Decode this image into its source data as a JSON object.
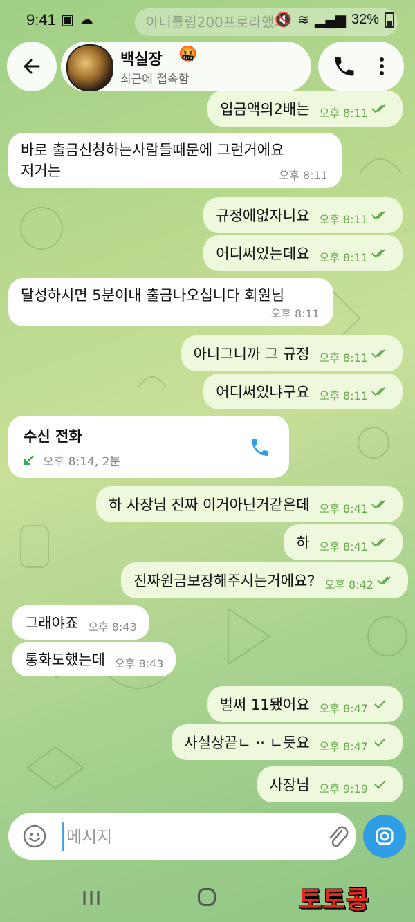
{
  "status_bar": {
    "time": "9:41",
    "battery": "32%",
    "notification_ghost": "아니를링200프로라했지"
  },
  "header": {
    "contact_name": "백실장",
    "contact_emoji": "🤬",
    "contact_status": "최근에 접속함",
    "back_label": "뒤로",
    "icons": [
      "back-arrow-icon",
      "phone-icon",
      "more-vert-icon"
    ]
  },
  "messages": [
    {
      "dir": "out",
      "text": "입금액의2배는",
      "time": "오후 8:11",
      "read": true
    },
    {
      "dir": "in",
      "text": "바로 출금신청하는사람들때문에 그런거에요\n저거는",
      "time": "오후 8:11"
    },
    {
      "dir": "out",
      "text": "규정에없자니요",
      "time": "오후 8:11",
      "read": true
    },
    {
      "dir": "out",
      "text": "어디써있는데요",
      "time": "오후 8:11",
      "read": true
    },
    {
      "dir": "in",
      "text": "달성하시면 5분이내 출금나오십니다 회원님",
      "time": "오후 8:11"
    },
    {
      "dir": "out",
      "text": "아니그니까 그 규정",
      "time": "오후 8:11",
      "read": true
    },
    {
      "dir": "out",
      "text": "어디써있냐구요",
      "time": "오후 8:11",
      "read": true
    },
    {
      "dir": "call",
      "title": "수신 전화",
      "meta": "오후 8:14, 2분"
    },
    {
      "dir": "out",
      "text": "하 사장님 진짜 이거아닌거같은데",
      "time": "오후 8:41",
      "read": true
    },
    {
      "dir": "out",
      "text": "하",
      "time": "오후 8:41",
      "read": true
    },
    {
      "dir": "out",
      "text": "진짜원금보장해주시는거에요?",
      "time": "오후 8:42",
      "read": true
    },
    {
      "dir": "in",
      "text": "그래야죠",
      "time": "오후 8:43"
    },
    {
      "dir": "in",
      "text": "통화도했는데",
      "time": "오후 8:43"
    },
    {
      "dir": "out",
      "text": "벌써 11됐어요",
      "time": "오후 8:47",
      "read": false
    },
    {
      "dir": "out",
      "text": "사실상끝ㄴ ·· ㄴ듯요",
      "time": "오후 8:47",
      "read": false
    },
    {
      "dir": "out",
      "text": "사장님",
      "time": "오후 9:19",
      "read": false
    }
  ],
  "composer": {
    "placeholder": "메시지"
  },
  "watermark": "토토콩",
  "colors": {
    "accent": "#2f9ee6",
    "check_green": "#5fa84a",
    "outgoing_bubble": "#eef8dd",
    "watermark_red": "#e12b1e"
  }
}
